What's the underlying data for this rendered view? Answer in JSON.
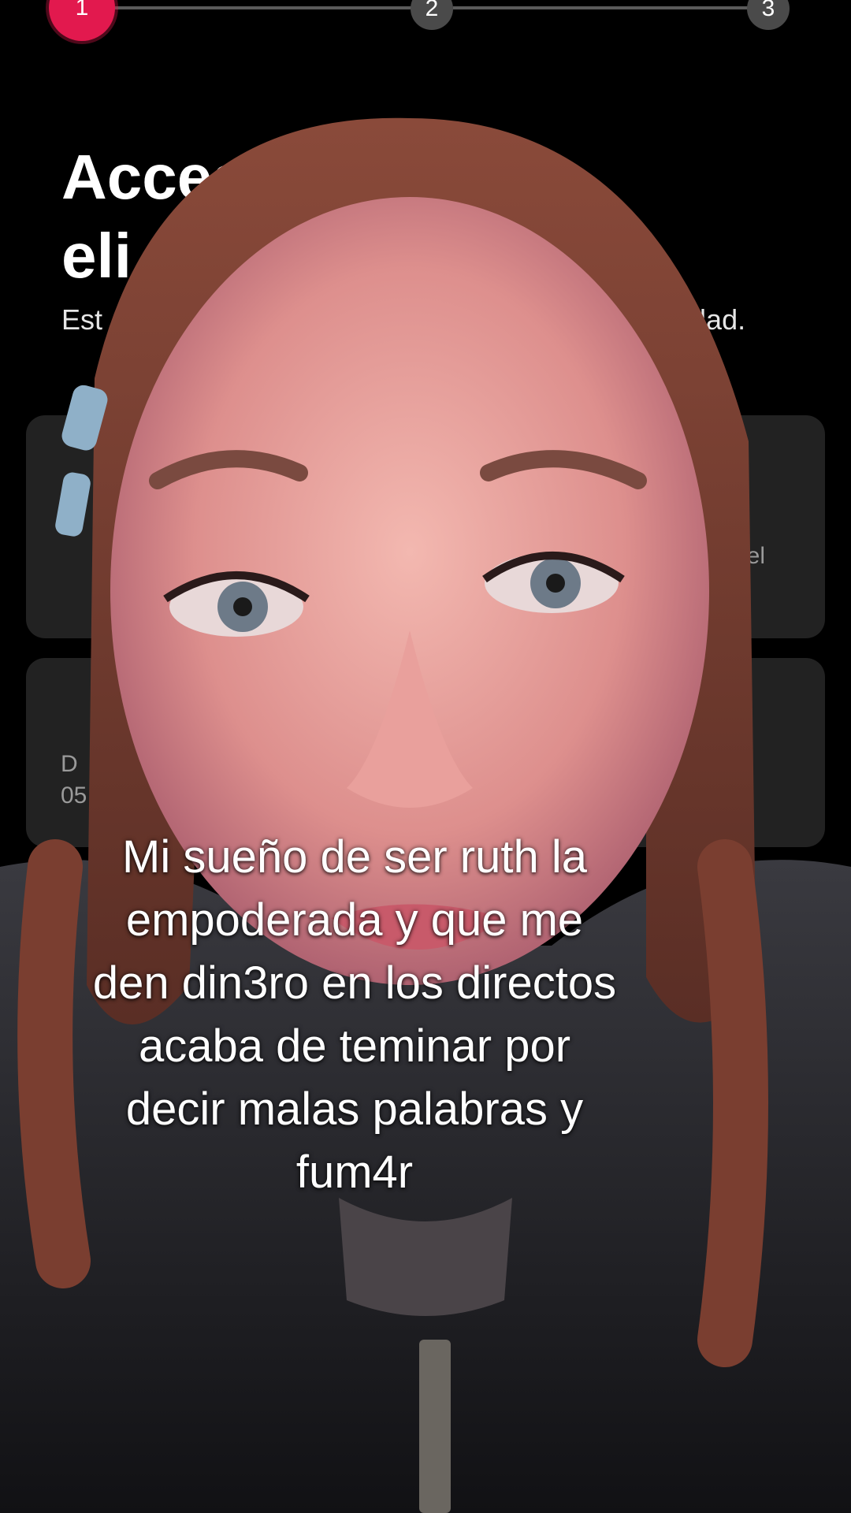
{
  "stepper": {
    "steps": [
      "1",
      "2",
      "3"
    ],
    "active_step": 1,
    "accent_color": "#e2194e"
  },
  "page": {
    "title_line1": "Acces",
    "title_line2": "eli",
    "subtitle_left": "Est",
    "subtitle_right": "nidad."
  },
  "cards": {
    "card1_fragment": "el",
    "card2_letter": "D",
    "card2_fragment": "05"
  },
  "caption": {
    "lines": [
      "Mi sueño de ser ruth la",
      "empoderada y que me",
      "den din3ro en los directos",
      "acaba de teminar por",
      "decir malas palabras y",
      "fum4r"
    ]
  }
}
